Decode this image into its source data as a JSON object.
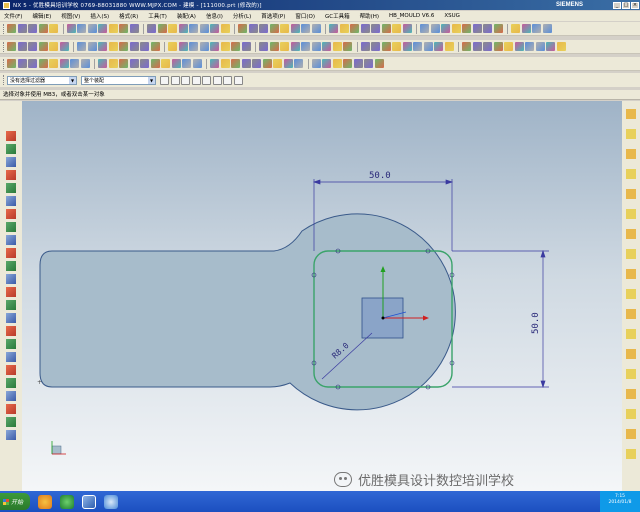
{
  "window": {
    "title": "NX 5 - 优胜模具培训学校 0769-88031880 WWW.MJPX.COM - 建模 - [111000.prt (修改的)]",
    "brand": "SIEMENS"
  },
  "menubar": {
    "items": [
      "文件(F)",
      "编辑(E)",
      "视图(V)",
      "插入(S)",
      "格式(R)",
      "工具(T)",
      "装配(A)",
      "信息(I)",
      "分析(L)",
      "首选项(P)",
      "窗口(O)",
      "GC工具箱",
      "帮助(H)",
      "HB_MOULD V6.6",
      "XSUG"
    ]
  },
  "filter_bar": {
    "type_filter": "没有选择过滤器",
    "scope_filter": "整个装配"
  },
  "cue_line": "选择对象并使用 MB3，或者双击某一对象",
  "drawing": {
    "width_dim": "50.0",
    "height_dim": "50.0",
    "radius_dim": "R8.0",
    "colors": {
      "body_fill": "#a7bccb",
      "outline": "#3a5a8a",
      "sketch": "#3aa36a",
      "dimension": "#3a3aa0",
      "axis_x": "#d02020",
      "axis_y": "#20a020",
      "axis_z": "#2050d0"
    }
  },
  "watermark": {
    "text": "优胜模具设计数控培训学校"
  },
  "taskbar": {
    "start_label": "开始",
    "clock_time": "7:15",
    "clock_date": "2014/01/8"
  }
}
